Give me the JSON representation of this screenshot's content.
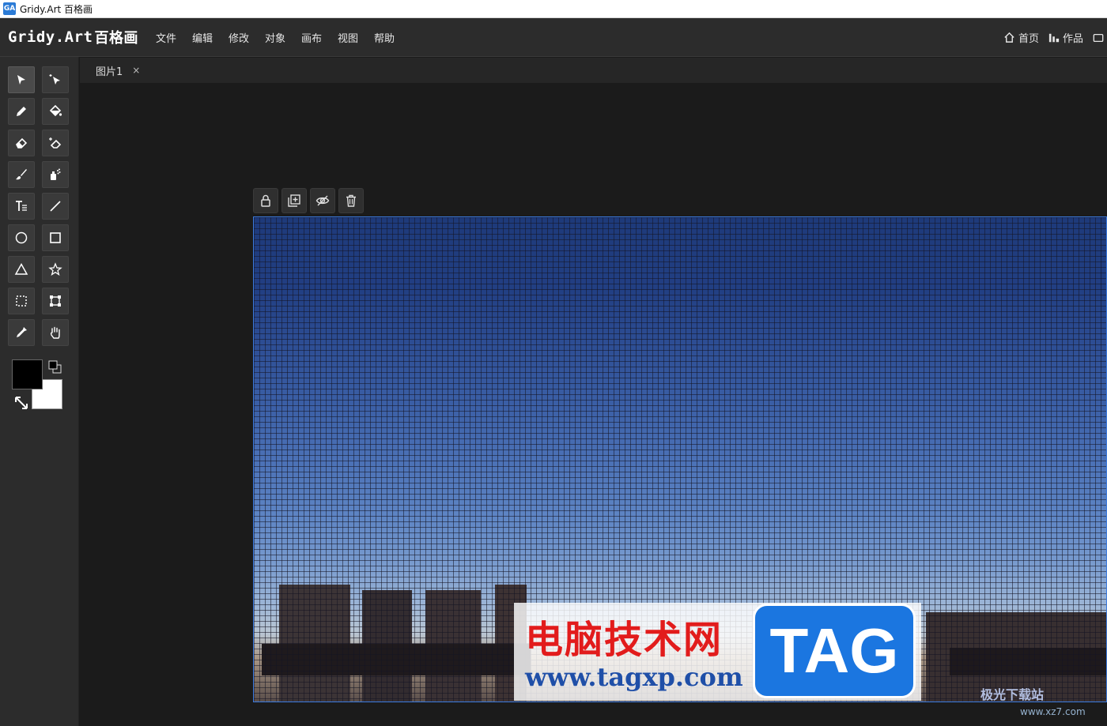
{
  "window": {
    "title": "Gridy.Art 百格画"
  },
  "logo": {
    "latin": "Gridy.Art",
    "cn": "百格画"
  },
  "menu": [
    "文件",
    "编辑",
    "修改",
    "对象",
    "画布",
    "视图",
    "帮助"
  ],
  "right_links": {
    "home": "首页",
    "works": "作品"
  },
  "tabs": [
    {
      "label": "图片1",
      "close": "×"
    }
  ],
  "tools": [
    "select-arrow",
    "magic-select",
    "pencil",
    "paint-bucket",
    "eraser",
    "magic-eraser",
    "brush",
    "spray",
    "text",
    "line",
    "ellipse",
    "rectangle",
    "triangle",
    "star",
    "marquee",
    "transform",
    "eyedropper",
    "hand"
  ],
  "colors": {
    "foreground": "#000000",
    "background": "#ffffff",
    "accent": "#3b7be0"
  },
  "layer_tools": [
    "lock-icon",
    "add-layer-icon",
    "visibility-icon",
    "trash-icon"
  ],
  "watermark": {
    "cn": "电脑技术网",
    "url": "www.tagxp.com",
    "tag": "TAG",
    "corner": "极光下载站",
    "corner_url": "www.xz7.com"
  }
}
